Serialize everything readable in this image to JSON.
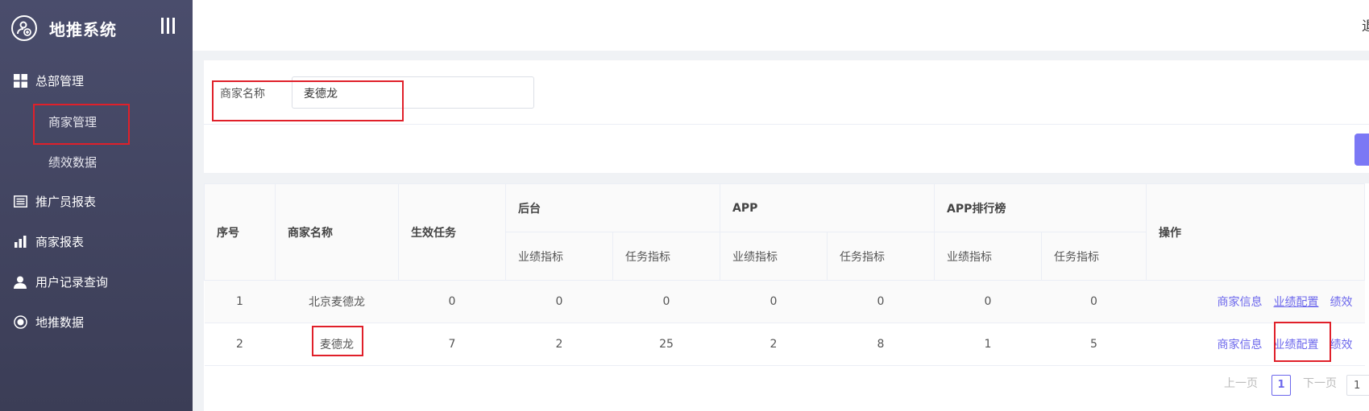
{
  "app": {
    "title": "地推系统"
  },
  "topbar": {
    "right_text": "退"
  },
  "sidebar": {
    "items": [
      {
        "label": "总部管理"
      },
      {
        "label": "商家管理"
      },
      {
        "label": "绩效数据"
      },
      {
        "label": "推广员报表"
      },
      {
        "label": "商家报表"
      },
      {
        "label": "用户记录查询"
      },
      {
        "label": "地推数据"
      }
    ]
  },
  "filter": {
    "label": "商家名称",
    "value": "麦德龙"
  },
  "table": {
    "headers": {
      "index": "序号",
      "merchant": "商家名称",
      "active_tasks": "生效任务",
      "backend": "后台",
      "app": "APP",
      "app_rank": "APP排行榜",
      "actions": "操作",
      "perf": "业绩指标",
      "task": "任务指标"
    },
    "rows": [
      {
        "index": "1",
        "merchant": "北京麦德龙",
        "active": "0",
        "b_perf": "0",
        "b_task": "0",
        "a_perf": "0",
        "a_task": "0",
        "r_perf": "0",
        "r_task": "0"
      },
      {
        "index": "2",
        "merchant": "麦德龙",
        "active": "7",
        "b_perf": "2",
        "b_task": "25",
        "a_perf": "2",
        "a_task": "8",
        "r_perf": "1",
        "r_task": "5"
      }
    ],
    "actions": {
      "info": "商家信息",
      "perf_config": "业绩配置",
      "perf_more": "绩效"
    }
  },
  "pagination": {
    "prev": "上一页",
    "current": "1",
    "next": "下一页",
    "jump_value": "1"
  },
  "colors": {
    "accent": "#6c67ec",
    "sidebar_bg": "#44465f",
    "highlight": "#e0202a"
  }
}
